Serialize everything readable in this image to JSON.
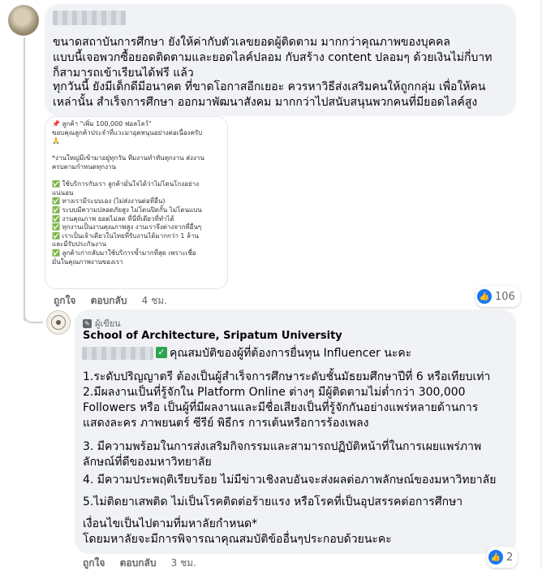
{
  "comment1": {
    "paragraph1": "ขนาดสถาบันการศึกษา ยังให้ค่ากับตัวเลขยอดผู้ติดตาม มากกว่าคุณภาพของบุคคล\nแบบนี้เจอพวกซื้อยอดติดตามและยอดไลค์ปลอม กับสร้าง content ปลอมๆ ด้วยเงินไม่กี่บาท\nก็สามารถเข้าเรียนได้ฟรี แล้ว",
    "paragraph2": "ทุกวันนี้ ยังมีเด็กดีมีอนาคต ที่ขาดโอกาสอีกเยอะ ควรหาวิธีส่งเสริมคนให้ถูกกลุ่ม เพื่อให้คน\nเหล่านั้น สำเร็จการศึกษา ออกมาพัฒนาสังคม มากกว่าไปสนับสนุนพวกคนที่มียอดไลค์สูง",
    "image_text": "📌 ลูกค้า \"เพิ่ม 100,000 ฟอลโลว์\"\nขอบคุณลูกค้าประจำที่แวะมาอุดหนุนอย่างต่อเนื่องครับ\n🙏\n\n*งานใหญ่มีเข้ามาอยู่ทุกวัน ทีมงานทำทันทุกงาน ส่งงาน\nครบตามกำหนดทุกงาน\n\n✅ ใช้บริการกับเรา ลูกค้ามั่นใจได้ว่าไม่โดนโกงอย่าง\nแน่นอน\n✅ ทางเรามีระบบเอง (ไม่ส่งงานต่อที่อื่น)\n✅ ระบบมีความปลอดภัยสูง ไม่โดนปิดกั้น ไม่โดนแบน\n✅ งานคุณภาพ ยอดไม่ลด ที่นี่ที่เดียวที่ทำได้\n✅ ทุกงานเป็นงานคุณภาพสูง งานเราจึงต่างจากที่อื่นๆ\n✅ เราเป็นเจ้าเดียวในไทยที่รับงานได้มากกว่า 1 ล้าน\nและมีรับประกันงาน\n✅ ลูกค้าเก่ากลับมาใช้บริการซ้ำมากที่สุด เพราะเชื่อ\nมั่นในคุณภาพงานของเรา",
    "like_label": "ถูกใจ",
    "reply_label": "ตอบกลับ",
    "time": "4 ชม.",
    "reaction_count": "106"
  },
  "comment2": {
    "author_badge": "ผู้เขียน",
    "page_name": "School of Architecture, Sripatum University",
    "first_line": "คุณสมบัติของผู้ที่ต้องการยื่นทุน Influencer นะคะ",
    "item1": "1.ระดับปริญญาตรี ต้องเป็นผู้สำเร็จการศึกษาระดับชั้นมัธยมศึกษาปีที่ 6 หรือเทียบเท่า",
    "item2": "2.มีผลงานเป็นที่รู้จักใน Platform Online ต่างๆ มีผู้ติดตามไม่ต่ำกว่า 300,000\nFollowers หรือ เป็นผู้ที่มีผลงานและมีชื่อเสียงเป็นที่รู้จักกันอย่างแพร่หลายด้านการ\nแสดงละคร ภาพยนตร์ ซีรีย์ พิธีกร การเต้นหรือการร้องเพลง",
    "item3": "3. มีความพร้อมในการส่งเสริมกิจกรรมและสามารถปฏิบัติหน้าที่ในการเผยแพร่ภาพ\nลักษณ์ที่ดีของมหาวิทยาลัย",
    "item4": "4. มีความประพฤติเรียบร้อย ไม่มีข่าวเชิงลบอันจะส่งผลต่อภาพลักษณ์ของมหาวิทยาลัย",
    "item5": "5.ไม่ติดยาเสพติด ไม่เป็นโรคติดต่อร้ายแรง หรือโรคที่เป็นอุปสรรคต่อการศึกษา",
    "footer": "เงื่อนไขเป็นไปตามที่มหาลัยกำหนด*\nโดยมหาลัยจะมีการพิจารณาคุณสมบัติข้ออื่นๆประกอบด้วยนะคะ",
    "like_label": "ถูกใจ",
    "reply_label": "ตอบกลับ",
    "time": "3 ชม.",
    "reaction_count": "2"
  },
  "icons": {
    "like": "like-icon",
    "badge": "author-badge-icon",
    "check": "check-mark-icon"
  },
  "colors": {
    "bubble": "#f0f2f5",
    "like_blue": "#1877f2",
    "meta_gray": "#65676b",
    "check_green": "#2ea44f"
  }
}
